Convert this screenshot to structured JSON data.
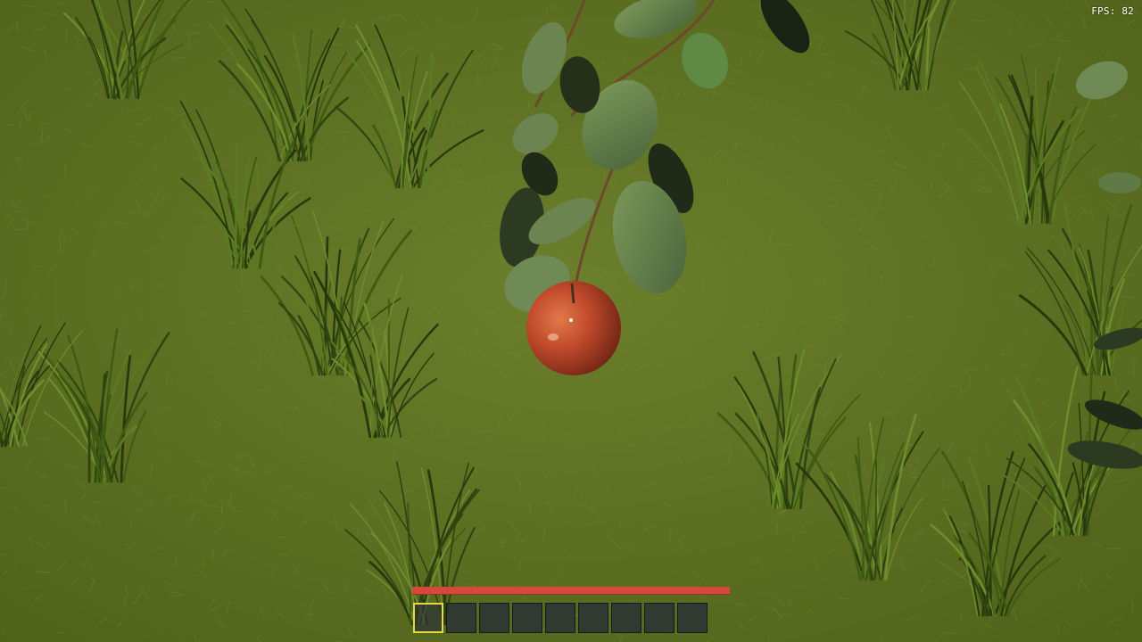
{
  "hud": {
    "fps_text": "FPS: 82",
    "health_fraction": 1.0,
    "health_color": "#d8473b",
    "selected_slot_color": "#e6d44a"
  },
  "hotbar": {
    "slot_count": 9,
    "selected_index": 0
  },
  "scene": {
    "ground_color": "#5f7424",
    "grass_blade_color": "#3f5a12",
    "leaf_color": "#5f7a3e",
    "apple_color": "#c24a2c"
  }
}
